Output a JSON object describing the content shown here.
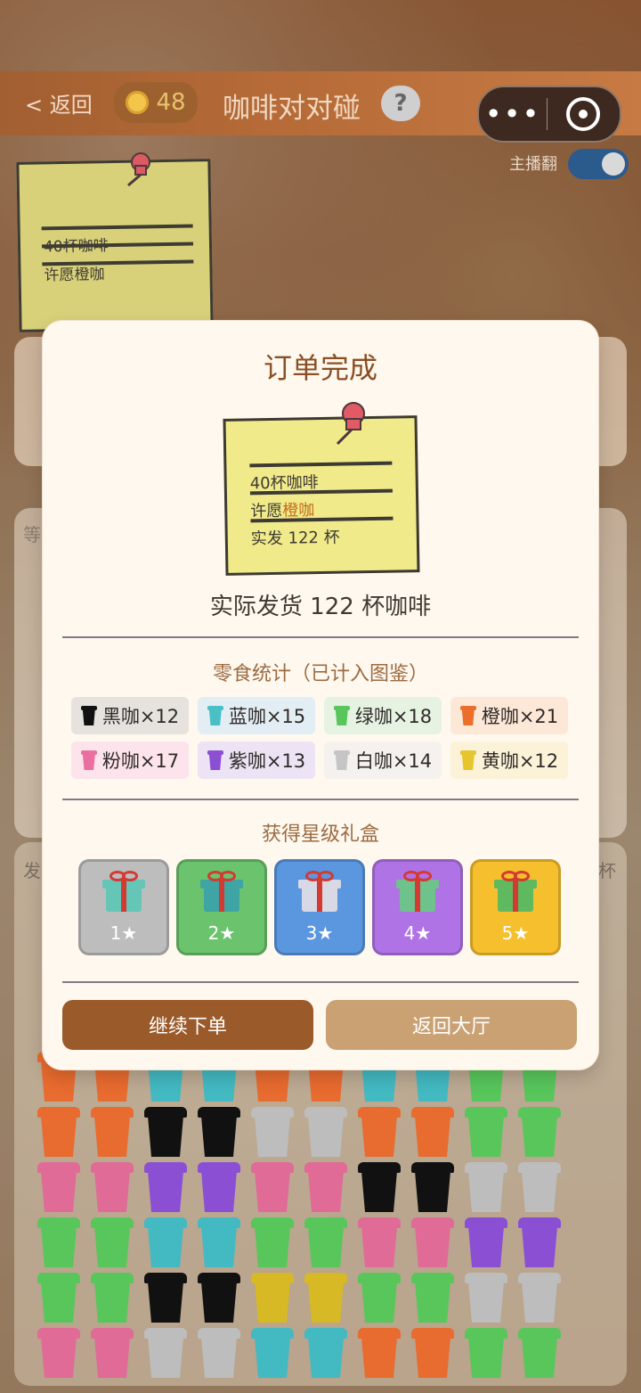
{
  "header": {
    "back_label": "< 返回",
    "coins": "48",
    "title": "咖啡对对碰",
    "help": "?"
  },
  "capsule": {
    "more_label": "•••",
    "target_label": ""
  },
  "stream_label": "主播翻",
  "note": {
    "line1": "40杯咖啡",
    "line2": "许愿橙咖"
  },
  "modal": {
    "title": "订单完成",
    "note": {
      "line1": "40杯咖啡",
      "line2a": "许愿",
      "line2b": "橙咖",
      "line3": "实发 122 杯"
    },
    "summary": "实际发货 122 杯咖啡",
    "snack_title": "零食统计（已计入图鉴）",
    "snacks": [
      {
        "label": "黑咖×12",
        "cup": "#111111",
        "bg": "#e6e2de"
      },
      {
        "label": "蓝咖×15",
        "cup": "#4ac0c6",
        "bg": "#e3eef4"
      },
      {
        "label": "绿咖×18",
        "cup": "#58c65b",
        "bg": "#e6f3e3"
      },
      {
        "label": "橙咖×21",
        "cup": "#eb6f2a",
        "bg": "#fde8d8"
      },
      {
        "label": "粉咖×17",
        "cup": "#ec6fa2",
        "bg": "#fde3ec"
      },
      {
        "label": "紫咖×13",
        "cup": "#8c4fd3",
        "bg": "#ece3f4"
      },
      {
        "label": "白咖×14",
        "cup": "#c5c5c5",
        "bg": "#f4f1ee"
      },
      {
        "label": "黄咖×12",
        "cup": "#e6c52d",
        "bg": "#fcf2d8"
      }
    ],
    "gift_title": "获得星级礼盒",
    "gifts": [
      {
        "label": "1★",
        "bg": "#bdbdbd",
        "box": "#65c5b7"
      },
      {
        "label": "2★",
        "bg": "#6bc36d",
        "box": "#3ea4a4"
      },
      {
        "label": "3★",
        "bg": "#5b97df",
        "box": "#d9d9e5"
      },
      {
        "label": "4★",
        "bg": "#b073e5",
        "box": "#6ec28b"
      },
      {
        "label": "5★",
        "bg": "#f6bf2d",
        "box": "#5fb95f"
      }
    ],
    "buttons": {
      "continue": "继续下单",
      "lobby": "返回大厅"
    }
  },
  "background_labels": {
    "left_prefix": "等",
    "send_prefix": "发",
    "cup_suffix": "杯"
  },
  "cup_grid": [
    [
      "#e86b2f",
      "#e86b2f",
      "#43b9c1",
      "#43b9c1",
      "#e86b2f",
      "#e86b2f",
      "#43b9c1",
      "#43b9c1",
      "#58c65b",
      "#58c65b"
    ],
    [
      "#e86b2f",
      "#e86b2f",
      "#111111",
      "#111111",
      "#bdbdbd",
      "#bdbdbd",
      "#e86b2f",
      "#e86b2f",
      "#58c65b",
      "#58c65b"
    ],
    [
      "#e06b97",
      "#e06b97",
      "#8a4fd3",
      "#8a4fd3",
      "#e06b97",
      "#e06b97",
      "#111111",
      "#111111",
      "#bdbdbd",
      "#bdbdbd"
    ],
    [
      "#58c65b",
      "#58c65b",
      "#43b9c1",
      "#43b9c1",
      "#58c65b",
      "#58c65b",
      "#e06b97",
      "#e06b97",
      "#8a4fd3",
      "#8a4fd3"
    ],
    [
      "#58c65b",
      "#58c65b",
      "#111111",
      "#111111",
      "#d6b925",
      "#d6b925",
      "#58c65b",
      "#58c65b",
      "#bdbdbd",
      "#bdbdbd"
    ],
    [
      "#e06b97",
      "#e06b97",
      "#bdbdbd",
      "#bdbdbd",
      "#43b9c1",
      "#43b9c1",
      "#e86b2f",
      "#e86b2f",
      "#58c65b",
      "#58c65b"
    ]
  ]
}
